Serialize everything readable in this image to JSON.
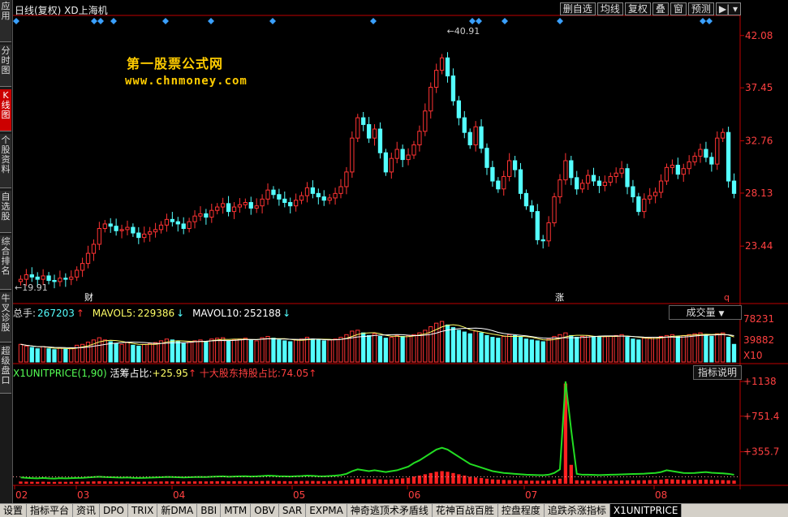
{
  "left_rail": [
    "应用",
    "分时图",
    "K线图",
    "个股资料",
    "自选股",
    "综合排名",
    "牛叉诊股",
    "超级盘口"
  ],
  "left_rail_active": 2,
  "title": "日线(复权) XD上海机",
  "toolbar": [
    "删自选",
    "均线",
    "复权",
    "叠",
    "窗",
    "预测"
  ],
  "brand": {
    "line1": "第一股票公式网",
    "line2": "www.chnmoney.com"
  },
  "price_axis": [
    "42.08",
    "37.45",
    "32.76",
    "28.13",
    "23.44"
  ],
  "annotations": {
    "high": "40.91",
    "low": "19.91",
    "cai": "财",
    "zhang": "涨",
    "q": "q"
  },
  "volume": {
    "total_label": "总手:",
    "total": "267203",
    "mavol5_label": "MAVOL5:",
    "mavol5": "229386",
    "mavol10_label": "MAVOL10:",
    "mavol10": "252188",
    "axis": [
      "78231",
      "39882",
      "X10"
    ],
    "dropdown": "成交量"
  },
  "indicator": {
    "name": "X1UNITPRICE(1,90)",
    "a_label": "活筹占比:",
    "a": "+25.95",
    "b_label": "十大股东持股占比:",
    "b": "74.05",
    "axis": [
      "+1138",
      "+751.4",
      "+355.7"
    ],
    "button": "指标说明"
  },
  "months": [
    "02",
    "03",
    "04",
    "05",
    "06",
    "07",
    "08"
  ],
  "bottom_tabs": [
    "设置",
    "指标平台",
    "资讯",
    "DPO",
    "TRIX",
    "新DMA",
    "BBI",
    "MTM",
    "OBV",
    "SAR",
    "EXPMA",
    "神奇逃顶术矛盾线",
    "花神百战百胜",
    "控盘程度",
    "追跌杀涨指标",
    "X1UNITPRICE"
  ],
  "bottom_active": 15,
  "colors": {
    "up": "#ff3333",
    "down": "#54ffff",
    "axis": "#c00000",
    "text_red": "#ff4040"
  },
  "chart_data": {
    "type": "candlestick",
    "ylim": [
      19.0,
      43.5
    ],
    "closes": [
      20.5,
      20.9,
      20.7,
      20.5,
      20.8,
      20.4,
      20.3,
      20.6,
      20.5,
      20.7,
      21.3,
      21.9,
      22.8,
      23.6,
      25.0,
      25.4,
      25.2,
      24.8,
      24.9,
      25.1,
      24.6,
      24.2,
      24.5,
      24.7,
      24.9,
      25.3,
      25.8,
      25.6,
      25.4,
      25.0,
      25.6,
      26.1,
      26.3,
      26.0,
      26.6,
      26.9,
      27.2,
      26.5,
      26.9,
      27.1,
      27.3,
      26.8,
      27.0,
      27.6,
      28.4,
      28.0,
      27.6,
      27.3,
      27.0,
      27.5,
      27.9,
      28.6,
      28.1,
      27.8,
      27.5,
      27.7,
      28.1,
      28.7,
      30.0,
      33.0,
      34.8,
      34.2,
      33.0,
      33.8,
      31.7,
      30.0,
      31.2,
      32.0,
      31.1,
      31.5,
      32.4,
      33.6,
      35.4,
      37.5,
      39.0,
      40.1,
      38.5,
      36.3,
      34.8,
      33.5,
      32.4,
      34.0,
      32.1,
      30.4,
      29.2,
      28.5,
      29.6,
      31.0,
      30.2,
      28.1,
      27.0,
      26.5,
      24.0,
      23.9,
      25.5,
      27.8,
      29.3,
      31.0,
      29.5,
      28.5,
      29.0,
      29.7,
      29.2,
      28.8,
      29.1,
      29.6,
      29.9,
      30.3,
      28.7,
      27.8,
      26.5,
      27.6,
      27.9,
      28.2,
      29.2,
      30.4,
      30.6,
      29.8,
      30.3,
      30.9,
      31.4,
      32.0,
      31.3,
      30.7,
      33.0,
      33.5,
      29.2,
      28.1
    ],
    "volume": [
      40,
      36,
      33,
      30,
      35,
      30,
      28,
      32,
      29,
      31,
      38,
      40,
      45,
      50,
      55,
      50,
      46,
      42,
      40,
      44,
      38,
      36,
      40,
      42,
      44,
      48,
      52,
      50,
      46,
      42,
      45,
      48,
      50,
      46,
      52,
      54,
      55,
      48,
      50,
      52,
      54,
      50,
      48,
      55,
      58,
      54,
      50,
      48,
      46,
      50,
      52,
      56,
      52,
      50,
      48,
      50,
      52,
      56,
      62,
      70,
      72,
      66,
      60,
      64,
      58,
      54,
      56,
      60,
      58,
      60,
      62,
      66,
      72,
      80,
      88,
      92,
      84,
      78,
      72,
      68,
      64,
      70,
      66,
      60,
      56,
      54,
      58,
      62,
      60,
      56,
      52,
      50,
      48,
      46,
      52,
      58,
      62,
      66,
      60,
      56,
      58,
      60,
      58,
      56,
      57,
      59,
      60,
      62,
      56,
      52,
      50,
      54,
      55,
      56,
      58,
      60,
      62,
      58,
      60,
      62,
      64,
      66,
      62,
      58,
      64,
      66,
      56,
      40
    ],
    "indicator": [
      70,
      66,
      62,
      60,
      64,
      60,
      58,
      62,
      60,
      62,
      64,
      66,
      70,
      74,
      78,
      74,
      72,
      70,
      68,
      70,
      66,
      64,
      66,
      68,
      70,
      72,
      76,
      74,
      72,
      70,
      72,
      74,
      76,
      74,
      78,
      80,
      82,
      78,
      80,
      82,
      84,
      80,
      82,
      86,
      90,
      88,
      84,
      82,
      80,
      84,
      86,
      90,
      88,
      84,
      82,
      86,
      90,
      96,
      110,
      140,
      160,
      150,
      140,
      150,
      140,
      130,
      140,
      150,
      170,
      190,
      230,
      260,
      300,
      340,
      380,
      400,
      380,
      340,
      300,
      260,
      220,
      200,
      180,
      160,
      140,
      130,
      120,
      115,
      110,
      105,
      100,
      98,
      96,
      95,
      100,
      120,
      160,
      1138,
      600,
      110,
      100,
      100,
      98,
      96,
      98,
      100,
      102,
      104,
      106,
      108,
      110,
      112,
      116,
      120,
      130,
      150,
      140,
      130,
      120,
      118,
      120,
      125,
      130,
      122,
      118,
      115,
      110,
      100
    ]
  }
}
